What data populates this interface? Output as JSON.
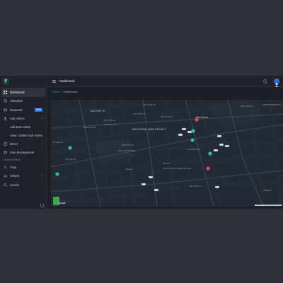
{
  "header": {
    "title": "Dashboard"
  },
  "breadcrumb": {
    "home": "Home",
    "separator": "/",
    "current": "Dashboard"
  },
  "sidebar": {
    "items": [
      {
        "label": "Dashboard",
        "icon": "dashboard-icon",
        "active": true
      },
      {
        "label": "Allocation",
        "icon": "allocation-icon"
      },
      {
        "label": "Requests",
        "icon": "requests-icon",
        "badge": "NEW"
      },
      {
        "label": "Sub-Admin",
        "icon": "sub-admin-icon",
        "expanded": true
      },
      {
        "label": "Add Sub-Admin",
        "sub": true
      },
      {
        "label": "View / Delete Sub-Admin",
        "sub": true
      },
      {
        "label": "Driver",
        "icon": "driver-icon",
        "chevron": true
      },
      {
        "label": "Fare Management",
        "icon": "fare-icon"
      }
    ],
    "section_management": "MANAGEMENT",
    "management_items": [
      {
        "label": "Trips",
        "icon": "trips-icon"
      },
      {
        "label": "Vehicle",
        "icon": "vehicle-icon",
        "chevron": true
      },
      {
        "label": "Search",
        "icon": "search-icon"
      }
    ]
  },
  "map": {
    "labels": {
      "sector_19": "SECTOR 19",
      "sector_41": "SECTOR 41",
      "sector_32": "SECTOR 32",
      "sector_20": "SECTOR 20",
      "sector_21": "SECTOR 21",
      "sector_28": "SECTOR 28",
      "sector_26": "SECTOR 26",
      "sector_17": "SECTOR 17",
      "sector_12": "SECTOR 12",
      "industrial_area_2": "INDUSTRIAL AREA PHASE 2",
      "industrial_area_1": "INDUSTRIAL AREA PHASE 1",
      "phase_10": "PHASE 10",
      "phase_11": "PHASE 11",
      "daria": "DARIA",
      "raipur": "RAIPUR KHURD",
      "panchkula": "Panchkula",
      "mohali": "Mohali",
      "manimajra": "MANIMAJRA",
      "bhagwanpura": "BHAGWANPURA",
      "mauli": "MAULI",
      "zirakpur": "Zirakpur",
      "sector_2": "SECTOR 2"
    },
    "google": "Google",
    "attribution": "Keyboard shortcuts  Map data ©2024"
  },
  "colors": {
    "accent": "#2f7bd8",
    "map_background": "#242a35",
    "road": "#384252",
    "marker_green": "#2bbf9a",
    "marker_red": "#e0455a"
  }
}
